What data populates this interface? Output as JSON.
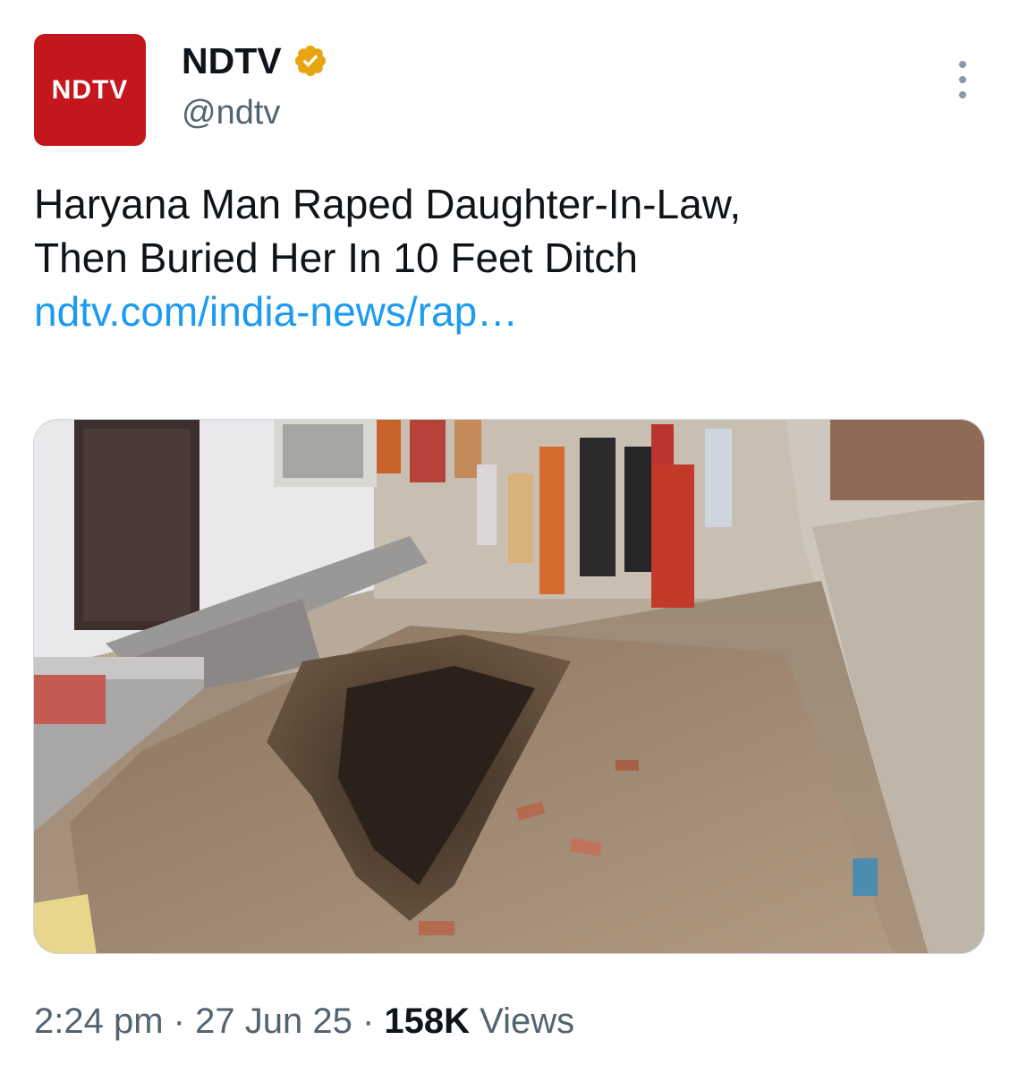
{
  "account": {
    "display_name": "NDTV",
    "handle": "@ndtv",
    "avatar_text": "NDTV",
    "verified": true,
    "brand_color": "#c4171d",
    "verified_color": "#e8a512"
  },
  "tweet": {
    "text_line1": "Haryana Man Raped Daughter-In-Law,",
    "text_line2": "Then Buried Her In 10 Feet Ditch",
    "link_text": "ndtv.com/india-news/rap…",
    "link_color": "#1d9bf0"
  },
  "media": {
    "kind": "photo"
  },
  "meta": {
    "time": "2:24 pm",
    "separator": "·",
    "date": "27 Jun 25",
    "views_count": "158K",
    "views_label": "Views"
  },
  "icons": {
    "more": "more-options-icon",
    "verified": "verified-badge-icon"
  }
}
